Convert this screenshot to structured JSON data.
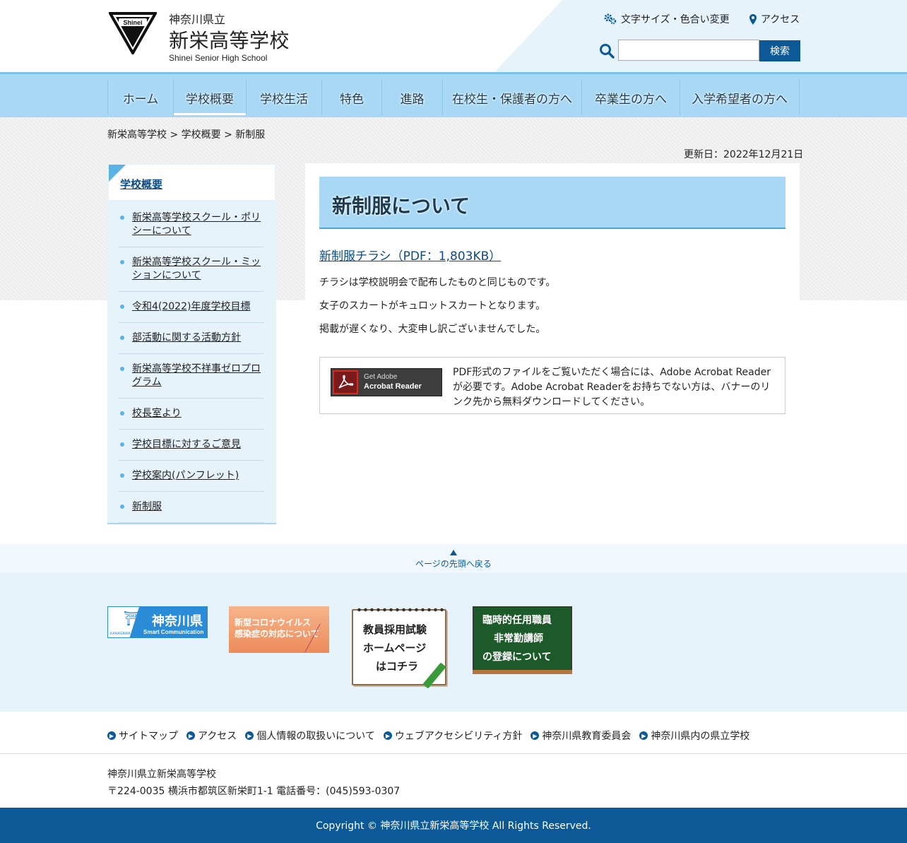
{
  "header": {
    "logo_alt": "Shinei",
    "pref": "神奈川県立",
    "school_name": "新栄高等学校",
    "school_name_en": "Shinei Senior High School",
    "font_color_label": "文字サイズ・色合い変更",
    "access_label": "アクセス",
    "search_placeholder": "",
    "search_button": "検索"
  },
  "nav": {
    "items": [
      {
        "label": "ホーム"
      },
      {
        "label": "学校概要"
      },
      {
        "label": "学校生活"
      },
      {
        "label": "特色"
      },
      {
        "label": "進路"
      },
      {
        "label": "在校生・保護者の方へ"
      },
      {
        "label": "卒業生の方へ"
      },
      {
        "label": "入学希望者の方へ"
      }
    ],
    "active_index": 1
  },
  "breadcrumb": "新栄高等学校 > 学校概要 > 新制服",
  "updated": "更新日：2022年12月21日",
  "sidebar": {
    "title": "学校概要",
    "items": [
      {
        "label": "新栄高等学校スクール・ポリシーについて"
      },
      {
        "label": "新栄高等学校スクール・ミッションについて"
      },
      {
        "label": "令和4(2022)年度学校目標"
      },
      {
        "label": "部活動に関する活動方針"
      },
      {
        "label": "新栄高等学校不祥事ゼロプログラム"
      },
      {
        "label": "校長室より"
      },
      {
        "label": "学校目標に対するご意見"
      },
      {
        "label": "学校案内(パンフレット)"
      },
      {
        "label": "新制服"
      }
    ]
  },
  "main": {
    "title": "新制服について",
    "pdf_link": "新制服チラシ（PDF：1,803KB）",
    "paragraphs": [
      "チラシは学校説明会で配布したものと同じものです。",
      "女子のスカートがキュロットスカートとなります。",
      "掲載が遅くなり、大変申し訳ございませんでした。"
    ],
    "acrobat": {
      "banner_line1": "Get Adobe",
      "banner_line2": "Acrobat Reader",
      "description": "PDF形式のファイルをご覧いただく場合には、Adobe Acrobat Readerが必要です。Adobe Acrobat Readerをお持ちでない方は、バナーのリンク先から無料ダウンロードしてください。"
    }
  },
  "pagetop": "ページの先頭へ戻る",
  "banners": {
    "kanagawa": {
      "label": "神奈川県",
      "sub": "Smart Communication",
      "small": "KANAGAWA"
    },
    "corona": {
      "line1": "新型コロナウイルス",
      "line2": "感染症の対応について"
    },
    "exam": {
      "line1": "教員採用試験",
      "line2": "ホームページ",
      "line3": "はコチラ"
    },
    "board": {
      "line1": "臨時的任用職員",
      "line2": "非常勤講師",
      "line3": "の登録について"
    }
  },
  "footer": {
    "links": [
      {
        "label": "サイトマップ"
      },
      {
        "label": "アクセス"
      },
      {
        "label": "個人情報の取扱いについて"
      },
      {
        "label": "ウェブアクセシビリティ方針"
      },
      {
        "label": "神奈川県教育委員会"
      },
      {
        "label": "神奈川県内の県立学校"
      }
    ],
    "address_name": "神奈川県立新栄高等学校",
    "address_line": "〒224-0035 横浜市都筑区新栄町1-1 電話番号：(045)593-0307",
    "copyright": "Copyright © 神奈川県立新栄高等学校 All Rights Reserved."
  },
  "colors": {
    "primary": "#0b5a97",
    "nav_bg": "#a8d8f4",
    "sidebar_bg": "#e6f3fb",
    "accent": "#5ab3e2"
  }
}
